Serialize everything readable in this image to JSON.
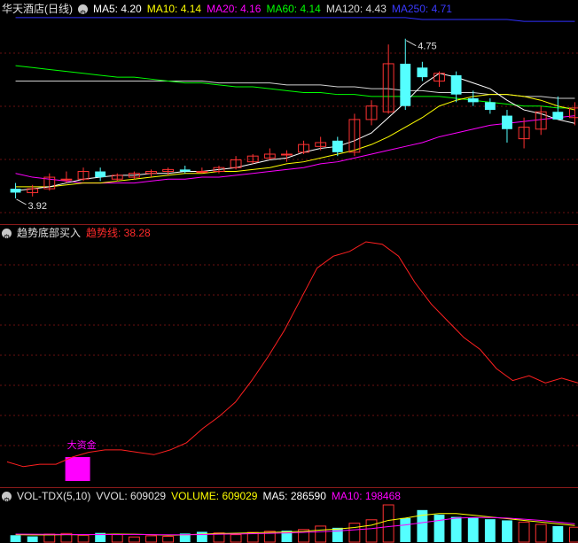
{
  "header1": {
    "title": "华天酒店(日线)",
    "ma5": "MA5: 4.20",
    "ma10": "MA10: 4.14",
    "ma20": "MA20: 4.16",
    "ma60": "MA60: 4.14",
    "ma120": "MA120: 4.43",
    "ma250": "MA250: 4.71"
  },
  "header2": {
    "title": "趋势底部买入",
    "trend": "趋势线: 38.28"
  },
  "header3": {
    "title": "VOL-TDX(5,10)",
    "vvol": "VVOL: 609029",
    "volume": "VOLUME: 609029",
    "ma5": "MA5: 286590",
    "ma10": "MA10: 198468"
  },
  "annotations": {
    "high": "4.75",
    "low": "3.92",
    "big_fund": "大资金"
  },
  "colors": {
    "up": "#ff3232",
    "down": "#54ffff",
    "ma5": "#ffffff",
    "ma10": "#ffff00",
    "ma20": "#ff00ff",
    "ma60": "#00ff00",
    "ma120": "#d0d0d0",
    "ma250": "#3030ff",
    "trend": "#ff2020",
    "big_fund": "#ff00ff"
  },
  "chart_data": [
    {
      "type": "candlestick",
      "title": "华天酒店(日线)",
      "ylim": [
        3.8,
        4.85
      ],
      "candles": [
        {
          "o": 3.97,
          "h": 4.0,
          "l": 3.92,
          "c": 3.95
        },
        {
          "o": 3.95,
          "h": 3.99,
          "l": 3.93,
          "c": 3.97
        },
        {
          "o": 3.97,
          "h": 4.05,
          "l": 3.96,
          "c": 4.03
        },
        {
          "o": 4.02,
          "h": 4.06,
          "l": 4.0,
          "c": 4.02
        },
        {
          "o": 4.02,
          "h": 4.08,
          "l": 4.01,
          "c": 4.06
        },
        {
          "o": 4.06,
          "h": 4.08,
          "l": 4.01,
          "c": 4.03
        },
        {
          "o": 4.02,
          "h": 4.05,
          "l": 4.01,
          "c": 4.04
        },
        {
          "o": 4.03,
          "h": 4.06,
          "l": 4.02,
          "c": 4.05
        },
        {
          "o": 4.05,
          "h": 4.07,
          "l": 4.03,
          "c": 4.06
        },
        {
          "o": 4.06,
          "h": 4.08,
          "l": 4.04,
          "c": 4.07
        },
        {
          "o": 4.07,
          "h": 4.09,
          "l": 4.05,
          "c": 4.06
        },
        {
          "o": 4.06,
          "h": 4.08,
          "l": 4.05,
          "c": 4.06
        },
        {
          "o": 4.06,
          "h": 4.09,
          "l": 4.05,
          "c": 4.08
        },
        {
          "o": 4.08,
          "h": 4.14,
          "l": 4.07,
          "c": 4.12
        },
        {
          "o": 4.11,
          "h": 4.15,
          "l": 4.1,
          "c": 4.14
        },
        {
          "o": 4.13,
          "h": 4.18,
          "l": 4.12,
          "c": 4.15
        },
        {
          "o": 4.15,
          "h": 4.17,
          "l": 4.11,
          "c": 4.15
        },
        {
          "o": 4.16,
          "h": 4.22,
          "l": 4.15,
          "c": 4.2
        },
        {
          "o": 4.19,
          "h": 4.24,
          "l": 4.17,
          "c": 4.21
        },
        {
          "o": 4.22,
          "h": 4.24,
          "l": 4.14,
          "c": 4.16
        },
        {
          "o": 4.16,
          "h": 4.36,
          "l": 4.14,
          "c": 4.33
        },
        {
          "o": 4.33,
          "h": 4.43,
          "l": 4.3,
          "c": 4.4
        },
        {
          "o": 4.37,
          "h": 4.72,
          "l": 4.36,
          "c": 4.62
        },
        {
          "o": 4.62,
          "h": 4.75,
          "l": 4.38,
          "c": 4.4
        },
        {
          "o": 4.6,
          "h": 4.63,
          "l": 4.53,
          "c": 4.55
        },
        {
          "o": 4.53,
          "h": 4.58,
          "l": 4.5,
          "c": 4.57
        },
        {
          "o": 4.56,
          "h": 4.58,
          "l": 4.42,
          "c": 4.46
        },
        {
          "o": 4.44,
          "h": 4.48,
          "l": 4.4,
          "c": 4.42
        },
        {
          "o": 4.42,
          "h": 4.44,
          "l": 4.36,
          "c": 4.38
        },
        {
          "o": 4.35,
          "h": 4.38,
          "l": 4.21,
          "c": 4.28
        },
        {
          "o": 4.23,
          "h": 4.34,
          "l": 4.18,
          "c": 4.29
        },
        {
          "o": 4.28,
          "h": 4.4,
          "l": 4.25,
          "c": 4.37
        },
        {
          "o": 4.37,
          "h": 4.45,
          "l": 4.33,
          "c": 4.33
        },
        {
          "o": 4.34,
          "h": 4.42,
          "l": 4.3,
          "c": 4.39
        }
      ],
      "ma": {
        "MA5": [
          3.96,
          3.97,
          3.98,
          4.0,
          4.02,
          4.03,
          4.04,
          4.04,
          4.05,
          4.05,
          4.06,
          4.06,
          4.07,
          4.08,
          4.1,
          4.12,
          4.13,
          4.16,
          4.18,
          4.19,
          4.22,
          4.26,
          4.34,
          4.42,
          4.51,
          4.57,
          4.55,
          4.52,
          4.49,
          4.43,
          4.38,
          4.36,
          4.33,
          4.31
        ],
        "MA10": [
          3.98,
          3.98,
          3.98,
          3.99,
          4.0,
          4.0,
          4.01,
          4.02,
          4.03,
          4.04,
          4.05,
          4.05,
          4.06,
          4.06,
          4.07,
          4.08,
          4.1,
          4.11,
          4.13,
          4.15,
          4.17,
          4.2,
          4.24,
          4.29,
          4.34,
          4.4,
          4.43,
          4.45,
          4.46,
          4.46,
          4.45,
          4.43,
          4.4,
          4.38
        ],
        "MA20": [
          4.05,
          4.03,
          4.02,
          4.01,
          4.0,
          4.0,
          4.0,
          4.0,
          4.01,
          4.02,
          4.02,
          4.03,
          4.03,
          4.04,
          4.05,
          4.06,
          4.07,
          4.08,
          4.1,
          4.11,
          4.13,
          4.15,
          4.17,
          4.19,
          4.21,
          4.24,
          4.26,
          4.28,
          4.3,
          4.31,
          4.32,
          4.33,
          4.34,
          4.35
        ],
        "MA60": [
          4.61,
          4.6,
          4.59,
          4.58,
          4.57,
          4.56,
          4.55,
          4.55,
          4.54,
          4.53,
          4.52,
          4.52,
          4.51,
          4.5,
          4.5,
          4.49,
          4.48,
          4.47,
          4.47,
          4.46,
          4.46,
          4.45,
          4.45,
          4.45,
          4.45,
          4.45,
          4.44,
          4.43,
          4.42,
          4.41,
          4.4,
          4.4,
          4.39,
          4.39
        ],
        "MA120": [
          4.53,
          4.53,
          4.53,
          4.53,
          4.53,
          4.53,
          4.53,
          4.53,
          4.53,
          4.53,
          4.53,
          4.53,
          4.52,
          4.52,
          4.52,
          4.52,
          4.51,
          4.51,
          4.51,
          4.5,
          4.5,
          4.49,
          4.49,
          4.48,
          4.48,
          4.47,
          4.47,
          4.47,
          4.46,
          4.46,
          4.45,
          4.45,
          4.44,
          4.44
        ],
        "MA250": [
          4.86,
          4.86,
          4.86,
          4.86,
          4.86,
          4.86,
          4.86,
          4.86,
          4.86,
          4.86,
          4.86,
          4.86,
          4.86,
          4.86,
          4.86,
          4.86,
          4.86,
          4.86,
          4.86,
          4.86,
          4.86,
          4.86,
          4.86,
          4.86,
          4.85,
          4.85,
          4.85,
          4.85,
          4.85,
          4.85,
          4.84,
          4.84,
          4.84,
          4.84
        ]
      }
    },
    {
      "type": "line",
      "title": "趋势底部买入",
      "ylim": [
        0,
        100
      ],
      "series": [
        {
          "name": "趋势线",
          "values": [
            8,
            6,
            7,
            7,
            10,
            12,
            13,
            13,
            12,
            11,
            13,
            16,
            22,
            27,
            33,
            42,
            52,
            63,
            76,
            89,
            94,
            96,
            100,
            99,
            94,
            83,
            74,
            67,
            60,
            55,
            47,
            42,
            44,
            41,
            43,
            41
          ]
        }
      ],
      "bar": {
        "label": "大资金",
        "index": 4,
        "value": 10
      }
    },
    {
      "type": "bar",
      "title": "VOL-TDX(5,10)",
      "ylim": [
        0,
        650000
      ],
      "values": [
        120000,
        100000,
        140000,
        150000,
        120000,
        160000,
        130000,
        90000,
        110000,
        100000,
        150000,
        180000,
        160000,
        130000,
        170000,
        190000,
        200000,
        220000,
        280000,
        250000,
        330000,
        390000,
        650000,
        420000,
        560000,
        480000,
        440000,
        430000,
        400000,
        380000,
        350000,
        310000,
        280000,
        260000
      ],
      "up": [
        false,
        false,
        true,
        true,
        true,
        false,
        true,
        true,
        true,
        true,
        false,
        false,
        true,
        true,
        true,
        true,
        false,
        true,
        true,
        false,
        true,
        true,
        true,
        false,
        false,
        false,
        false,
        false,
        false,
        false,
        true,
        true,
        false,
        true
      ],
      "ma5": [
        130000,
        125000,
        126000,
        130000,
        128000,
        134000,
        140000,
        138000,
        130000,
        120000,
        126000,
        140000,
        150000,
        155000,
        162000,
        170000,
        178000,
        188000,
        210000,
        228000,
        256000,
        296000,
        380000,
        420000,
        470000,
        500000,
        500000,
        470000,
        440000,
        410000,
        380000,
        350000,
        320000,
        290000
      ],
      "ma10": [
        140000,
        138000,
        136000,
        134000,
        132000,
        131000,
        132000,
        133000,
        130000,
        128000,
        128000,
        132000,
        138000,
        142000,
        147000,
        152000,
        160000,
        170000,
        182000,
        196000,
        214000,
        236000,
        270000,
        300000,
        340000,
        380000,
        420000,
        430000,
        430000,
        420000,
        400000,
        380000,
        350000,
        320000
      ]
    }
  ]
}
